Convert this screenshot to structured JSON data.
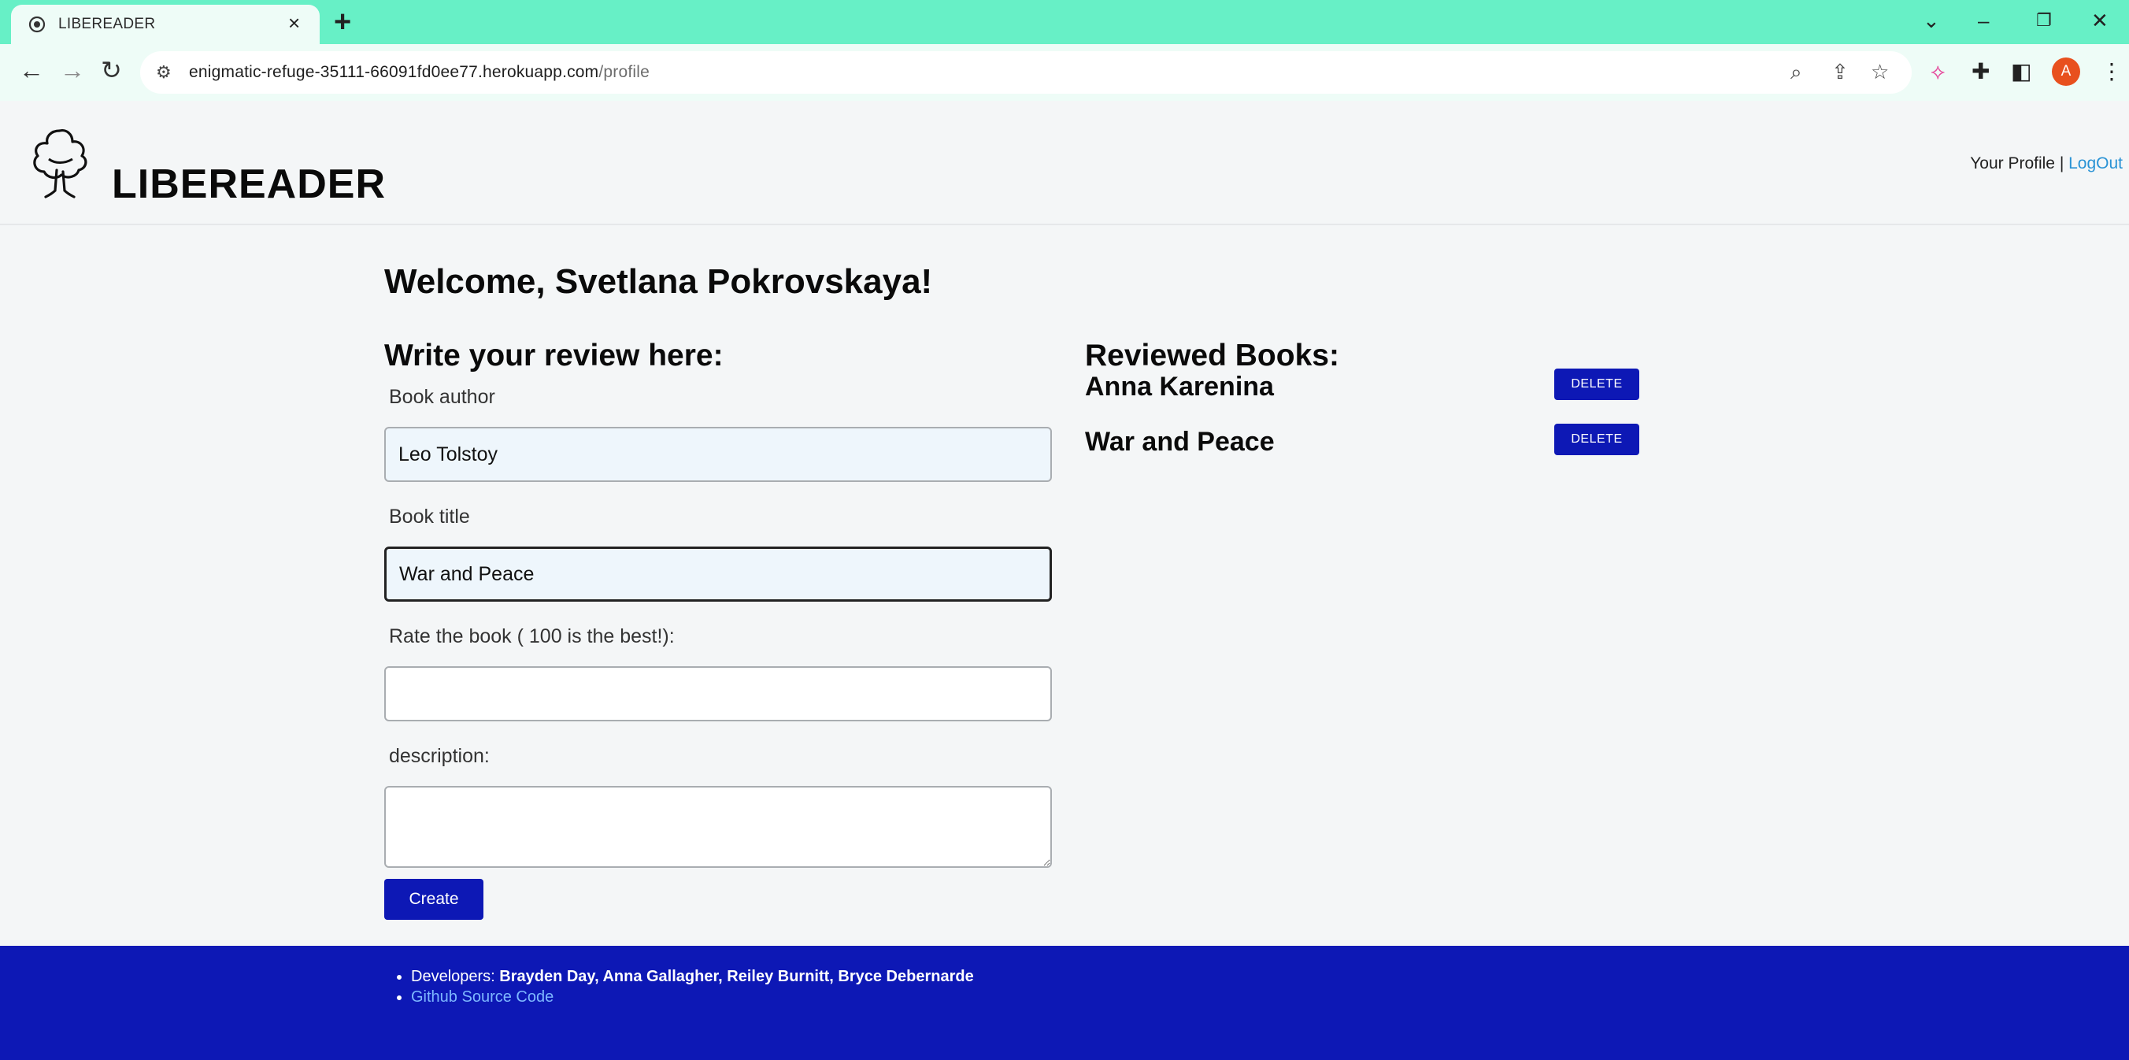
{
  "browser": {
    "tab_title": "LIBEREADER",
    "url_host": "enigmatic-refuge-35111-66091fd0ee77.herokuapp.com",
    "url_path": "/profile",
    "avatar_letter": "A"
  },
  "header": {
    "brand": "LIBEREADER",
    "profile_link": "Your Profile",
    "separator": " | ",
    "logout_link": "LogOut"
  },
  "main": {
    "welcome": "Welcome, Svetlana Pokrovskaya!",
    "form": {
      "heading": "Write your review here:",
      "author_label": "Book author",
      "author_value": "Leo Tolstoy",
      "title_label": "Book title",
      "title_value": "War and Peace",
      "rating_label": "Rate the book ( 100 is the best!):",
      "rating_value": "",
      "description_label": "description:",
      "description_value": "",
      "submit_label": "Create"
    },
    "reviews": {
      "heading": "Reviewed Books:",
      "delete_label": "DELETE",
      "items": [
        {
          "title": "Anna Karenina"
        },
        {
          "title": "War and Peace"
        }
      ]
    }
  },
  "footer": {
    "developers_prefix": "Developers: ",
    "developers_names": "Brayden Day, Anna Gallagher, Reiley Burnitt, Bryce Debernarde",
    "github_link": "Github Source Code"
  },
  "colors": {
    "browser_chrome": "#67f0c6",
    "primary_button": "#0d18b5",
    "footer_bg": "#0d18b5",
    "link": "#2a93d5"
  }
}
